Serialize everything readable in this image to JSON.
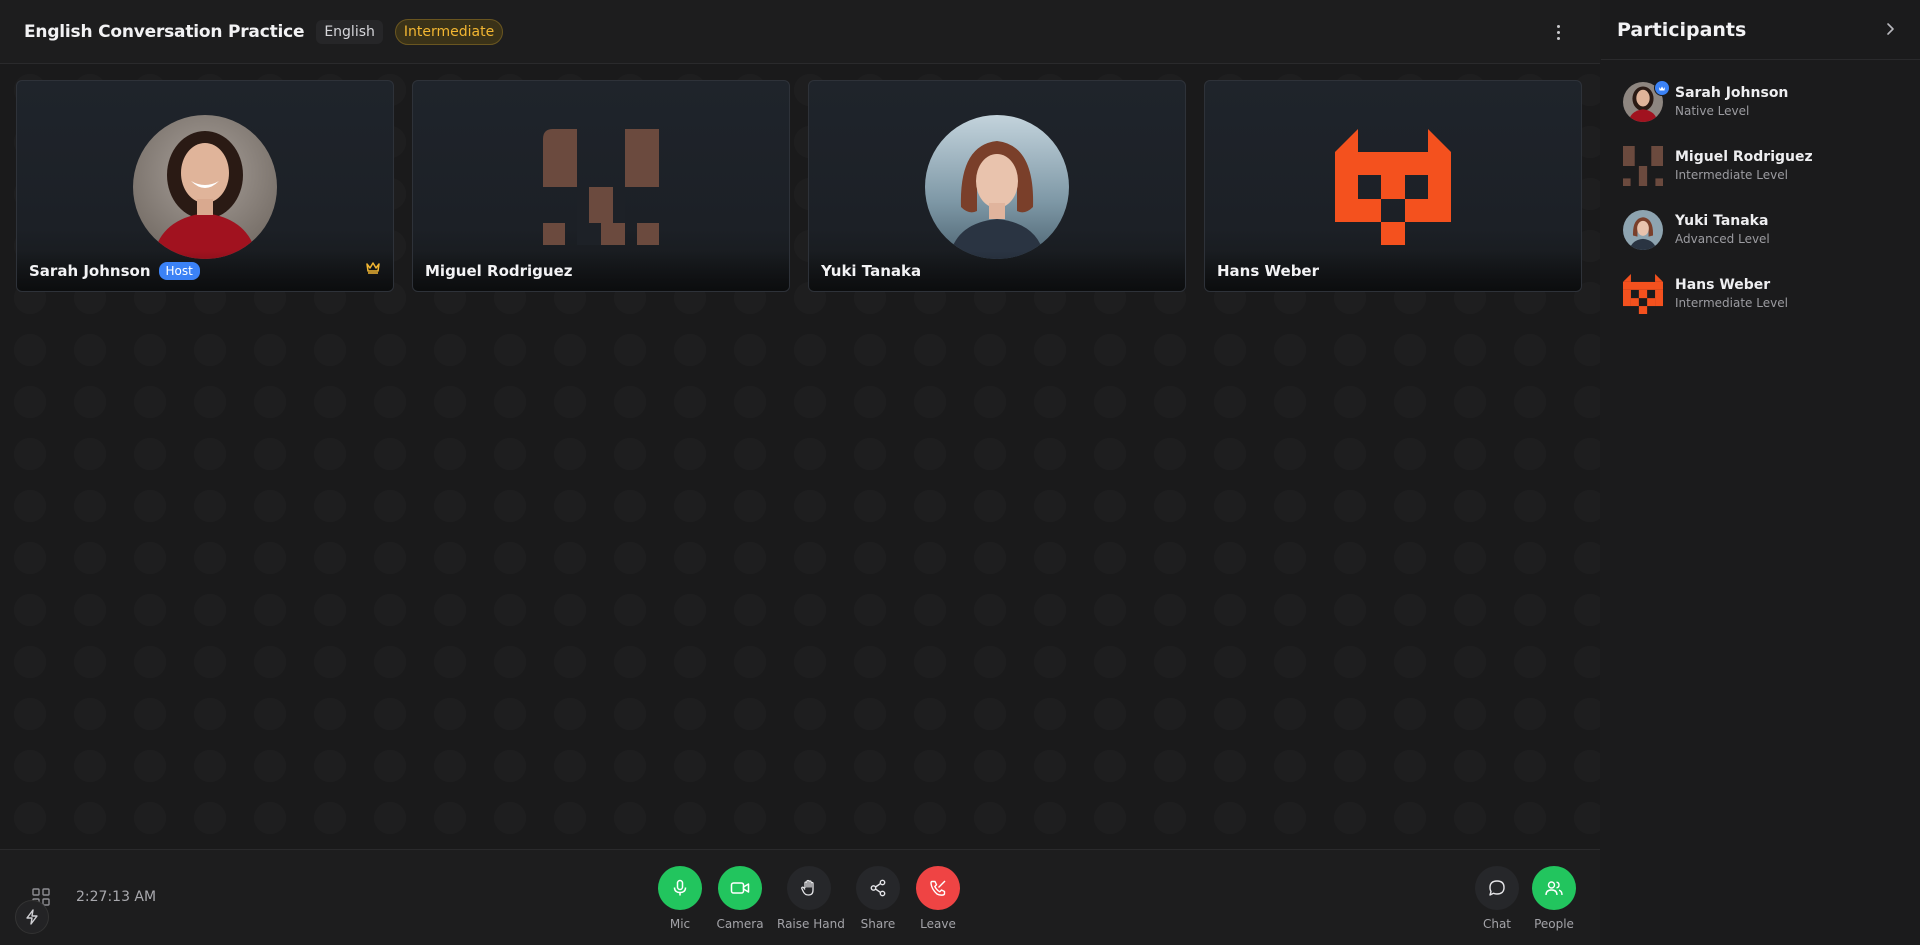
{
  "header": {
    "title": "English Conversation Practice",
    "language": "English",
    "level": "Intermediate"
  },
  "tiles": [
    {
      "name": "Sarah Johnson",
      "badge": "Host",
      "avatar": "photo-woman-red-sweater"
    },
    {
      "name": "Miguel Rodriguez",
      "avatar": "brown-pixel-identicon"
    },
    {
      "name": "Yuki Tanaka",
      "avatar": "photo-woman-bob-hair"
    },
    {
      "name": "Hans Weber",
      "avatar": "orange-pixel-identicon"
    }
  ],
  "footer": {
    "clock": "2:27:13 AM",
    "controls": {
      "mic": "Mic",
      "camera": "Camera",
      "raise_hand": "Raise Hand",
      "share": "Share",
      "leave": "Leave",
      "chat": "Chat",
      "people": "People"
    }
  },
  "sidebar": {
    "title": "Participants",
    "participants": [
      {
        "name": "Sarah Johnson",
        "level": "Native Level"
      },
      {
        "name": "Miguel Rodriguez",
        "level": "Intermediate Level"
      },
      {
        "name": "Yuki Tanaka",
        "level": "Advanced Level"
      },
      {
        "name": "Hans Weber",
        "level": "Intermediate Level"
      }
    ]
  },
  "colors": {
    "accent_green": "#22c55e",
    "leave_red": "#ef4444",
    "host_blue": "#3b82f6",
    "level_amber": "#f2b632",
    "identicon_brown": "#6b4a3e",
    "identicon_orange": "#f4511e"
  }
}
